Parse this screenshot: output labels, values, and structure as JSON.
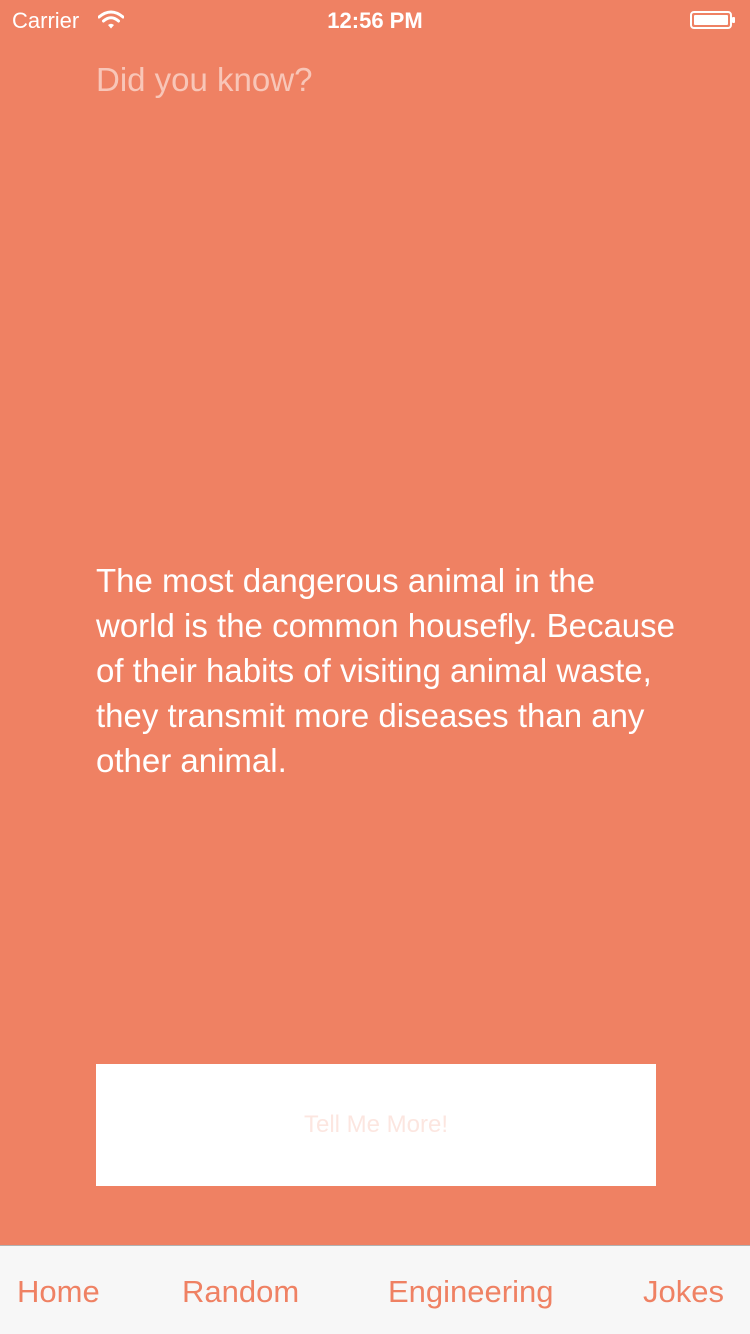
{
  "status_bar": {
    "carrier": "Carrier",
    "time": "12:56 PM",
    "wifi_icon": "wifi-icon",
    "battery_icon": "battery-icon",
    "battery_level": 1.0
  },
  "main": {
    "heading": "Did you know?",
    "fact": "The most dangerous animal in the world is the common housefly. Because of their habits of visiting animal waste, they transmit more diseases than any other animal.",
    "button_label": "Tell Me More!"
  },
  "tab_bar": {
    "items": [
      {
        "label": "Home"
      },
      {
        "label": "Random"
      },
      {
        "label": "Engineering"
      },
      {
        "label": "Jokes"
      }
    ]
  },
  "colors": {
    "background": "#EF8163",
    "accent": "#EF8163",
    "button_background": "#FFFFFF",
    "tab_bar_background": "#F7F7F7"
  }
}
